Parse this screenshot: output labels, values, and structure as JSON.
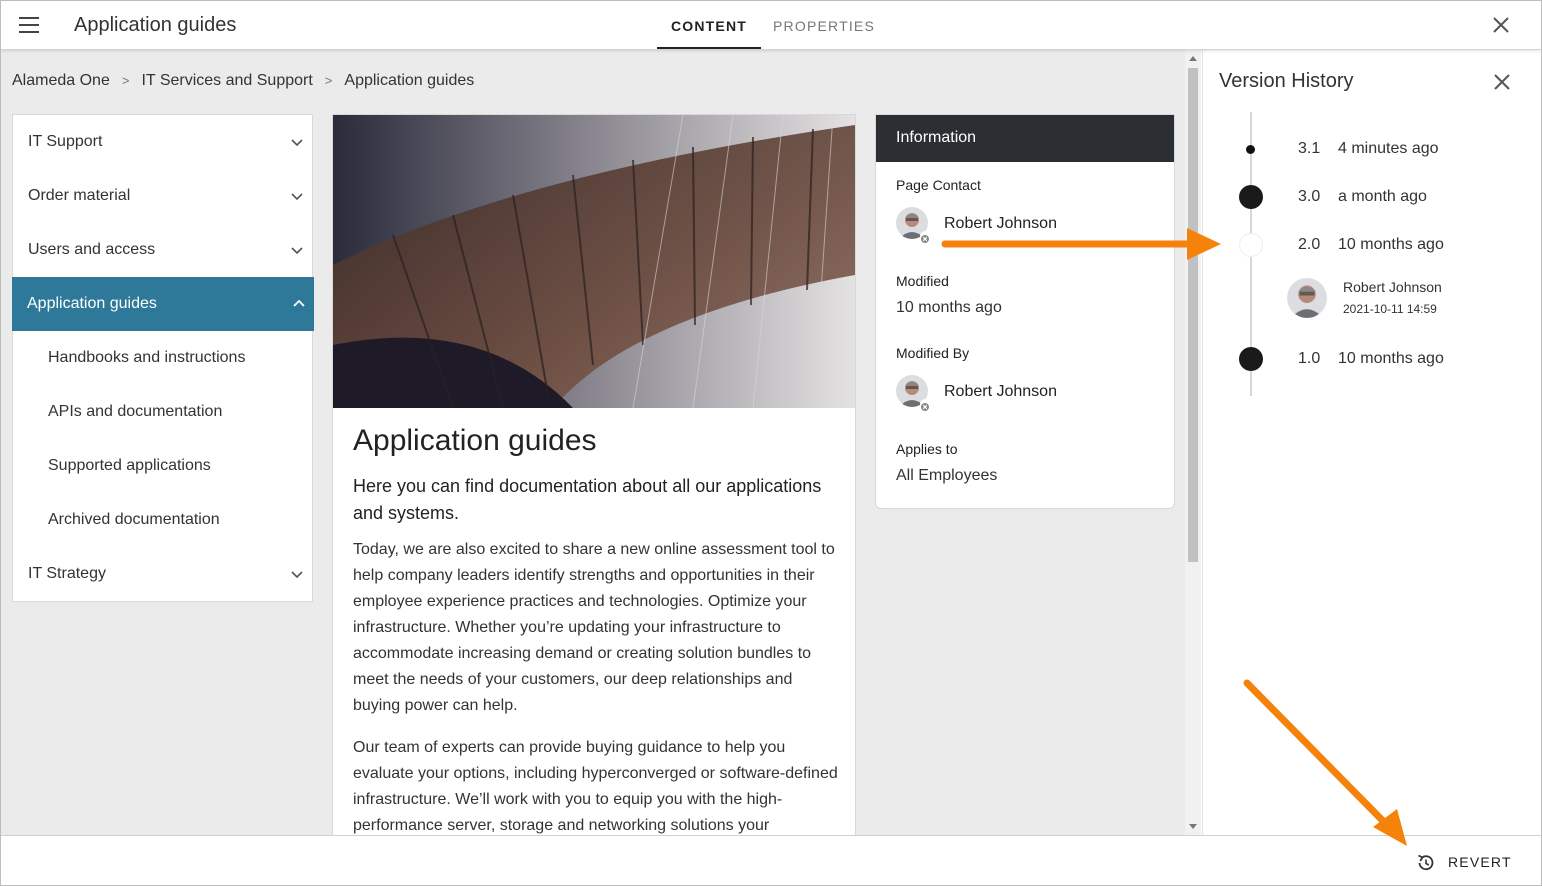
{
  "header": {
    "title": "Application guides",
    "tabs": [
      {
        "label": "CONTENT",
        "active": true
      },
      {
        "label": "PROPERTIES",
        "active": false
      }
    ]
  },
  "breadcrumb": [
    "Alameda One",
    "IT Services and Support",
    "Application guides"
  ],
  "nav": {
    "items": [
      {
        "label": "IT Support"
      },
      {
        "label": "Order material"
      },
      {
        "label": "Users and access"
      },
      {
        "label": "Application guides"
      },
      {
        "label": "Handbooks and instructions"
      },
      {
        "label": "APIs and documentation"
      },
      {
        "label": "Supported applications"
      },
      {
        "label": "Archived documentation"
      },
      {
        "label": "IT Strategy"
      }
    ]
  },
  "article": {
    "title": "Application guides",
    "lead": "Here you can find documentation about all our applications and systems.",
    "paragraphs": [
      "Today, we are also excited to share a new online assessment tool to help company leaders identify strengths and opportunities in their employee experience practices and technologies. Optimize your infrastructure. Whether you’re updating your infrastructure to accommodate increasing demand or creating solution bundles to meet the needs of your customers, our deep relationships and buying power can help.",
      "Our team of experts can provide buying guidance to help you evaluate your options, including hyperconverged or software-defined infrastructure. We’ll work with you to equip you with the high-performance server, storage and networking solutions your"
    ]
  },
  "info": {
    "heading": "Information",
    "page_contact_label": "Page Contact",
    "page_contact_name": "Robert Johnson",
    "modified_label": "Modified",
    "modified_value": "10 months ago",
    "modified_by_label": "Modified By",
    "modified_by_name": "Robert Johnson",
    "applies_to_label": "Applies to",
    "applies_to_value": "All Employees"
  },
  "version_history": {
    "title": "Version History",
    "versions": [
      {
        "number": "3.1",
        "time": "4 minutes ago"
      },
      {
        "number": "3.0",
        "time": "a month ago"
      },
      {
        "number": "2.0",
        "time": "10 months ago",
        "selected": true
      },
      {
        "number": "1.0",
        "time": "10 months ago"
      }
    ],
    "selected_author": "Robert Johnson",
    "selected_date": "2021-10-11 14:59"
  },
  "footer": {
    "revert_label": "REVERT"
  },
  "colors": {
    "accent": "#2e7999",
    "info_header": "#2b2f33",
    "annotation_arrow": "#f5820b"
  },
  "icons": [
    "menu-icon",
    "close-icon",
    "chevron-down-icon",
    "chevron-up-icon",
    "revert-icon"
  ]
}
